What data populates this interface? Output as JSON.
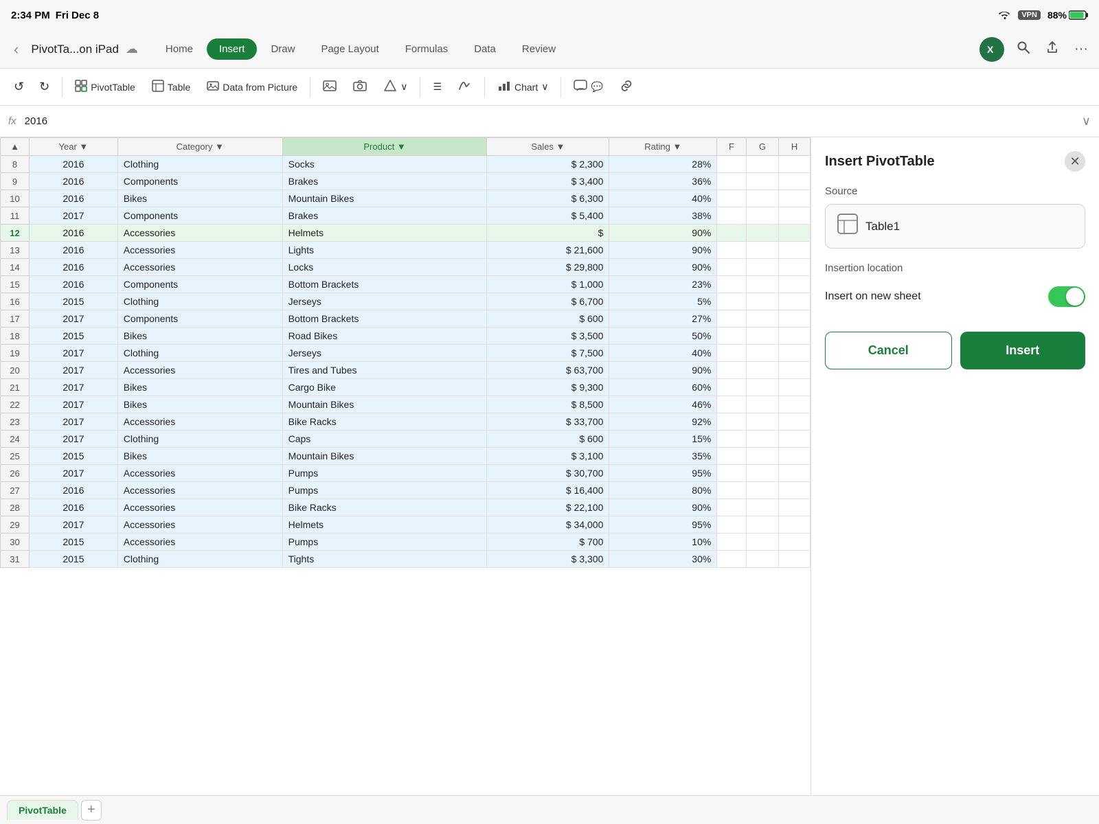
{
  "status": {
    "time": "2:34 PM",
    "day": "Fri Dec 8",
    "wifi": "wifi",
    "vpn": "VPN",
    "battery_pct": "88%"
  },
  "titlebar": {
    "back": "‹",
    "filename": "PivotTa...on iPad",
    "cloud_icon": "☁",
    "tabs": [
      "Home",
      "Insert",
      "Draw",
      "Page Layout",
      "Formulas",
      "Data",
      "Review"
    ],
    "active_tab": "Insert",
    "search_icon": "🔍",
    "share_icon": "⬆",
    "more_icon": "···"
  },
  "toolbar": {
    "undo": "↺",
    "redo": "↻",
    "pivot_table": "PivotTable",
    "table": "Table",
    "data_from_picture": "Data from Picture",
    "pictures": "🖼",
    "camera": "📷",
    "shapes": "⬡",
    "text": "☰",
    "signature": "✏",
    "chart": "Chart",
    "comment": "💬",
    "link": "🔗"
  },
  "formula_bar": {
    "fx": "fx",
    "value": "2016",
    "expand": "∨"
  },
  "columns": [
    "▲",
    "Year",
    "Category",
    "Product",
    "Sales",
    "Rating",
    "F",
    "G",
    "H"
  ],
  "rows": [
    {
      "num": "8",
      "year": "2016",
      "category": "Clothing",
      "product": "Socks",
      "sales": "$ 2,300",
      "rating": "28%"
    },
    {
      "num": "9",
      "year": "2016",
      "category": "Components",
      "product": "Brakes",
      "sales": "$ 3,400",
      "rating": "36%"
    },
    {
      "num": "10",
      "year": "2016",
      "category": "Bikes",
      "product": "Mountain Bikes",
      "sales": "$ 6,300",
      "rating": "40%"
    },
    {
      "num": "11",
      "year": "2017",
      "category": "Components",
      "product": "Brakes",
      "sales": "$ 5,400",
      "rating": "38%"
    },
    {
      "num": "12",
      "year": "2016",
      "category": "Accessories",
      "product": "Helmets",
      "sales": "$",
      "rating": "90%",
      "active": true
    },
    {
      "num": "13",
      "year": "2016",
      "category": "Accessories",
      "product": "Lights",
      "sales": "$ 21,600",
      "rating": "90%"
    },
    {
      "num": "14",
      "year": "2016",
      "category": "Accessories",
      "product": "Locks",
      "sales": "$ 29,800",
      "rating": "90%"
    },
    {
      "num": "15",
      "year": "2016",
      "category": "Components",
      "product": "Bottom Brackets",
      "sales": "$ 1,000",
      "rating": "23%"
    },
    {
      "num": "16",
      "year": "2015",
      "category": "Clothing",
      "product": "Jerseys",
      "sales": "$ 6,700",
      "rating": "5%"
    },
    {
      "num": "17",
      "year": "2017",
      "category": "Components",
      "product": "Bottom Brackets",
      "sales": "$ 600",
      "rating": "27%"
    },
    {
      "num": "18",
      "year": "2015",
      "category": "Bikes",
      "product": "Road Bikes",
      "sales": "$ 3,500",
      "rating": "50%"
    },
    {
      "num": "19",
      "year": "2017",
      "category": "Clothing",
      "product": "Jerseys",
      "sales": "$ 7,500",
      "rating": "40%"
    },
    {
      "num": "20",
      "year": "2017",
      "category": "Accessories",
      "product": "Tires and Tubes",
      "sales": "$ 63,700",
      "rating": "90%"
    },
    {
      "num": "21",
      "year": "2017",
      "category": "Bikes",
      "product": "Cargo Bike",
      "sales": "$ 9,300",
      "rating": "60%"
    },
    {
      "num": "22",
      "year": "2017",
      "category": "Bikes",
      "product": "Mountain Bikes",
      "sales": "$ 8,500",
      "rating": "46%"
    },
    {
      "num": "23",
      "year": "2017",
      "category": "Accessories",
      "product": "Bike Racks",
      "sales": "$ 33,700",
      "rating": "92%"
    },
    {
      "num": "24",
      "year": "2017",
      "category": "Clothing",
      "product": "Caps",
      "sales": "$ 600",
      "rating": "15%"
    },
    {
      "num": "25",
      "year": "2015",
      "category": "Bikes",
      "product": "Mountain Bikes",
      "sales": "$ 3,100",
      "rating": "35%"
    },
    {
      "num": "26",
      "year": "2017",
      "category": "Accessories",
      "product": "Pumps",
      "sales": "$ 30,700",
      "rating": "95%"
    },
    {
      "num": "27",
      "year": "2016",
      "category": "Accessories",
      "product": "Pumps",
      "sales": "$ 16,400",
      "rating": "80%"
    },
    {
      "num": "28",
      "year": "2016",
      "category": "Accessories",
      "product": "Bike Racks",
      "sales": "$ 22,100",
      "rating": "90%"
    },
    {
      "num": "29",
      "year": "2017",
      "category": "Accessories",
      "product": "Helmets",
      "sales": "$ 34,000",
      "rating": "95%"
    },
    {
      "num": "30",
      "year": "2015",
      "category": "Accessories",
      "product": "Pumps",
      "sales": "$ 700",
      "rating": "10%"
    },
    {
      "num": "31",
      "year": "2015",
      "category": "Clothing",
      "product": "Tights",
      "sales": "$ 3,300",
      "rating": "30%"
    }
  ],
  "panel": {
    "title": "Insert PivotTable",
    "close_icon": "✕",
    "source_label": "Source",
    "source_icon": "⊞",
    "source_name": "Table1",
    "insertion_location_label": "Insertion location",
    "insert_on_new_sheet": "Insert on new sheet",
    "toggle_on": true,
    "cancel_label": "Cancel",
    "insert_label": "Insert"
  },
  "sheet_tabs": {
    "active_tab": "PivotTable",
    "add_icon": "+"
  },
  "colors": {
    "accent": "#1a7f3c",
    "selected_bg": "#e8f5e9"
  }
}
